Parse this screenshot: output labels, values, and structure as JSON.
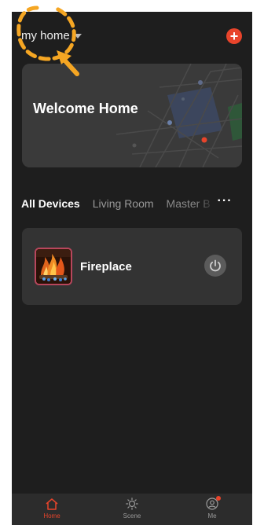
{
  "header": {
    "home_name": "my home",
    "add_label": "+"
  },
  "welcome": {
    "text": "Welcome Home"
  },
  "tabs": {
    "items": [
      {
        "label": "All Devices"
      },
      {
        "label": "Living Room"
      },
      {
        "label": "Master B"
      }
    ],
    "more": "···"
  },
  "device": {
    "name": "Fireplace",
    "thumbnail_icon": "fireplace-image",
    "power_icon": "power-icon"
  },
  "nav": {
    "items": [
      {
        "label": "Home",
        "icon": "house-icon"
      },
      {
        "label": "Scene",
        "icon": "sun-icon"
      },
      {
        "label": "Me",
        "icon": "user-icon"
      }
    ]
  },
  "colors": {
    "accent": "#e8442b",
    "background": "#1e1e1e",
    "card": "#333333",
    "annotation": "#f5a623"
  }
}
